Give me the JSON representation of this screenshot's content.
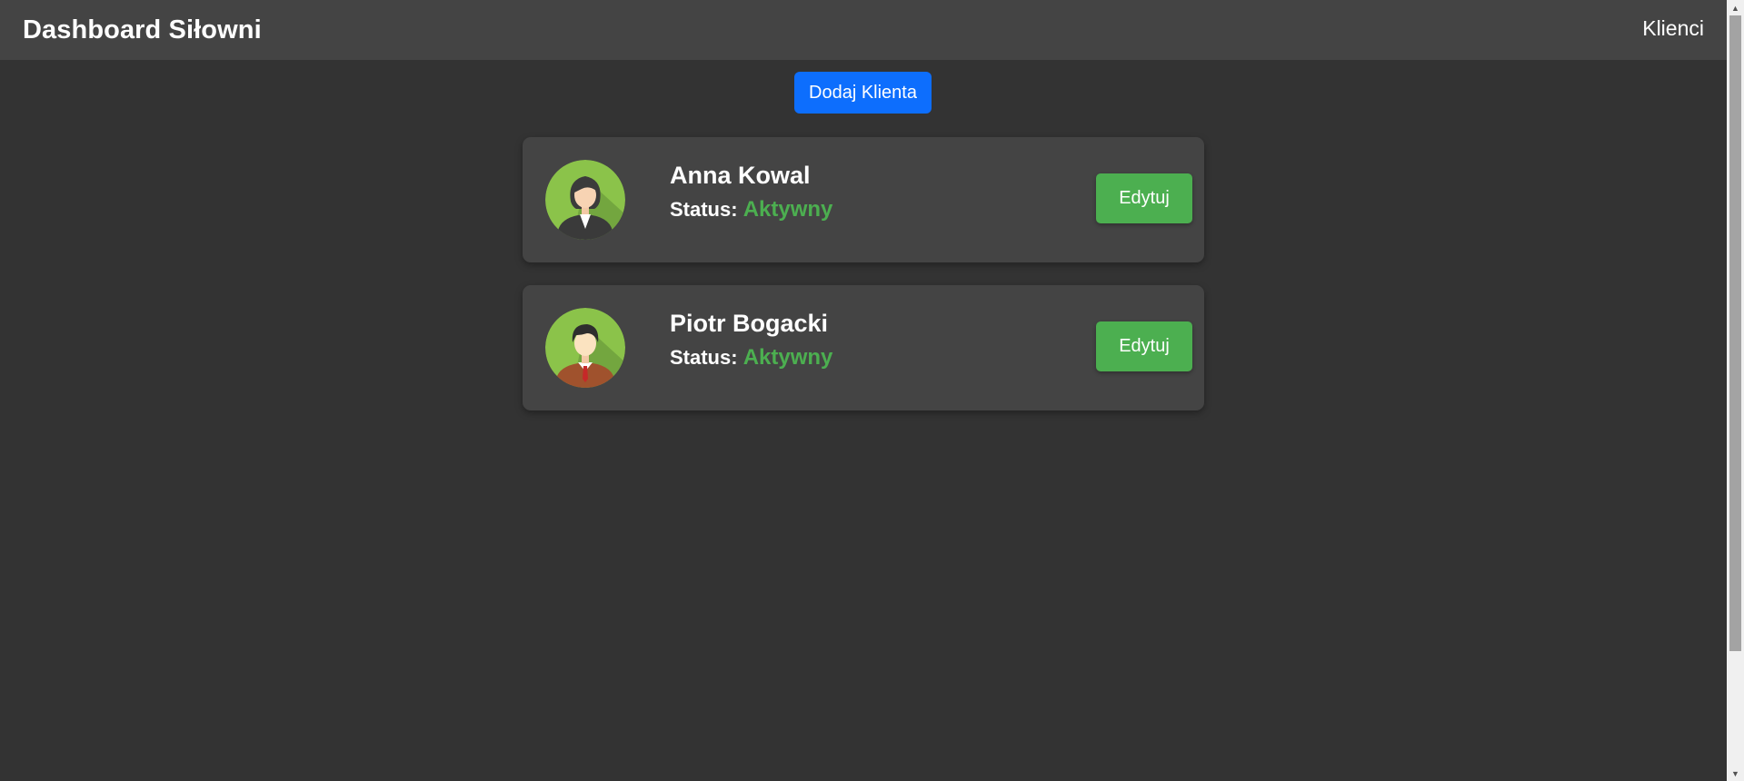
{
  "header": {
    "title": "Dashboard Siłowni",
    "nav_link": "Klienci"
  },
  "actions": {
    "add_client_label": "Dodaj Klienta"
  },
  "clients": [
    {
      "name": "Anna Kowal",
      "status_label": "Status:",
      "status_value": "Aktywny",
      "edit_label": "Edytuj",
      "avatar_icon": "female-avatar-icon"
    },
    {
      "name": "Piotr Bogacki",
      "status_label": "Status:",
      "status_value": "Aktywny",
      "edit_label": "Edytuj",
      "avatar_icon": "male-avatar-icon"
    }
  ],
  "colors": {
    "background": "#333333",
    "navbar": "#444444",
    "card": "#444444",
    "primary_button": "#0d6efd",
    "edit_button": "#4caf50",
    "status_active": "#4caf50"
  }
}
